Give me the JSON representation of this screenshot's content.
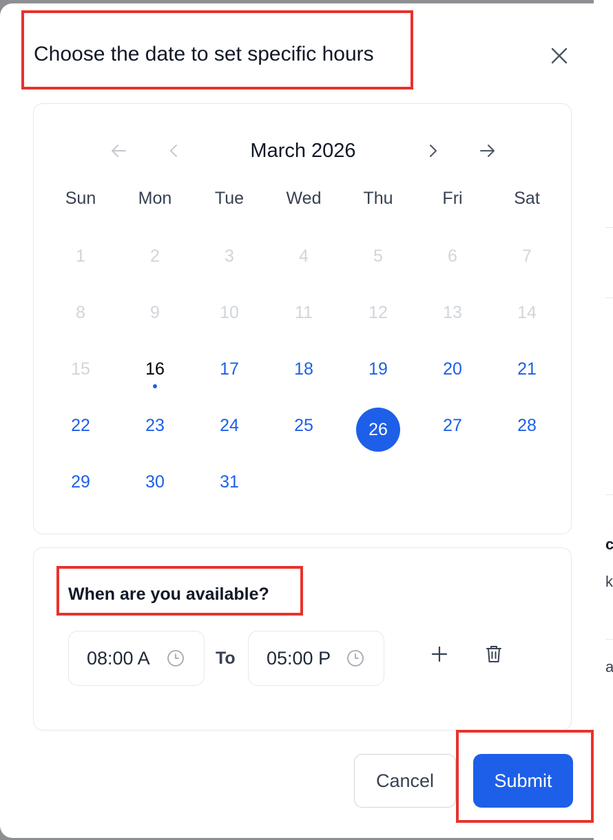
{
  "dialog": {
    "title": "Choose the date to set specific hours"
  },
  "calendar": {
    "month_label": "March 2026",
    "weekdays": [
      "Sun",
      "Mon",
      "Tue",
      "Wed",
      "Thu",
      "Fri",
      "Sat"
    ],
    "days": [
      {
        "label": "1",
        "state": "disabled"
      },
      {
        "label": "2",
        "state": "disabled"
      },
      {
        "label": "3",
        "state": "disabled"
      },
      {
        "label": "4",
        "state": "disabled"
      },
      {
        "label": "5",
        "state": "disabled"
      },
      {
        "label": "6",
        "state": "disabled"
      },
      {
        "label": "7",
        "state": "disabled"
      },
      {
        "label": "8",
        "state": "disabled"
      },
      {
        "label": "9",
        "state": "disabled"
      },
      {
        "label": "10",
        "state": "disabled"
      },
      {
        "label": "11",
        "state": "disabled"
      },
      {
        "label": "12",
        "state": "disabled"
      },
      {
        "label": "13",
        "state": "disabled"
      },
      {
        "label": "14",
        "state": "disabled"
      },
      {
        "label": "15",
        "state": "disabled"
      },
      {
        "label": "16",
        "state": "today"
      },
      {
        "label": "17",
        "state": "available"
      },
      {
        "label": "18",
        "state": "available"
      },
      {
        "label": "19",
        "state": "available"
      },
      {
        "label": "20",
        "state": "available"
      },
      {
        "label": "21",
        "state": "available"
      },
      {
        "label": "22",
        "state": "available"
      },
      {
        "label": "23",
        "state": "available"
      },
      {
        "label": "24",
        "state": "available"
      },
      {
        "label": "25",
        "state": "available"
      },
      {
        "label": "26",
        "state": "selected"
      },
      {
        "label": "27",
        "state": "available"
      },
      {
        "label": "28",
        "state": "available"
      },
      {
        "label": "29",
        "state": "available"
      },
      {
        "label": "30",
        "state": "available"
      },
      {
        "label": "31",
        "state": "available"
      }
    ]
  },
  "availability": {
    "heading": "When are you available?",
    "start_time": "08:00 A",
    "separator": "To",
    "end_time": "05:00 P"
  },
  "actions": {
    "cancel_label": "Cancel",
    "submit_label": "Submit"
  },
  "background": {
    "fragments": [
      "c",
      "k",
      "a"
    ]
  },
  "icons": {
    "close": "close-icon",
    "first_page": "arrow-left-icon",
    "prev": "chevron-left-icon",
    "next": "chevron-right-icon",
    "last_page": "arrow-right-icon",
    "clock": "clock-icon",
    "add": "plus-icon",
    "delete": "trash-icon"
  },
  "colors": {
    "accent": "#1d5fe8",
    "highlight": "#e8322d",
    "disabled_day": "#d1d5db",
    "text": "#111827"
  }
}
